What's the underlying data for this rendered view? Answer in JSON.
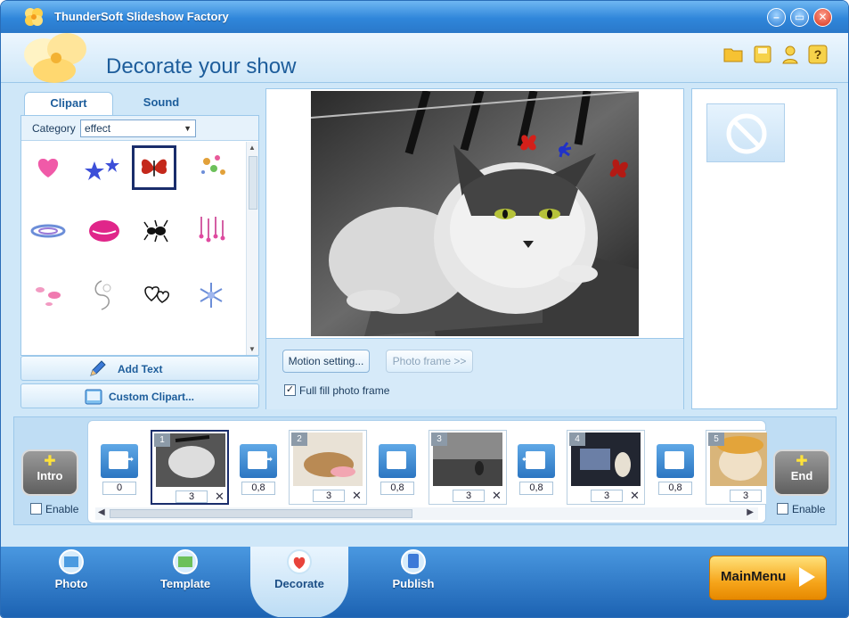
{
  "window": {
    "title": "ThunderSoft Slideshow Factory"
  },
  "header": {
    "title": "Decorate your show",
    "icons": [
      "folder-icon",
      "save-icon",
      "help-person-icon",
      "help-icon"
    ]
  },
  "left_panel": {
    "tabs": [
      {
        "label": "Clipart",
        "active": true
      },
      {
        "label": "Sound",
        "active": false
      }
    ],
    "category_label": "Category",
    "category_value": "effect",
    "clipart_items": [
      "heart",
      "stars",
      "butterfly",
      "sparkles",
      "ring",
      "lips",
      "ant",
      "drops",
      "petals",
      "swirl",
      "hearts",
      "snowflake"
    ],
    "selected_clipart": "butterfly",
    "add_text_label": "Add Text",
    "custom_clipart_label": "Custom Clipart..."
  },
  "preview": {
    "motion_setting_label": "Motion setting...",
    "photo_frame_label": "Photo frame >>",
    "full_fill_label": "Full fill photo frame",
    "full_fill_checked": true
  },
  "timeline": {
    "intro": {
      "label": "Intro",
      "enable_label": "Enable"
    },
    "end": {
      "label": "End",
      "enable_label": "Enable"
    },
    "transitions": [
      "0",
      "0,8",
      "0,8",
      "0,8",
      "0,8"
    ],
    "slides": [
      {
        "num": "1",
        "duration": "3"
      },
      {
        "num": "2",
        "duration": "3"
      },
      {
        "num": "3",
        "duration": "3"
      },
      {
        "num": "4",
        "duration": "3"
      },
      {
        "num": "5",
        "duration": "3"
      }
    ]
  },
  "nav": {
    "items": [
      {
        "label": "Photo"
      },
      {
        "label": "Template"
      },
      {
        "label": "Decorate",
        "active": true
      },
      {
        "label": "Publish"
      }
    ],
    "main_menu_label": "MainMenu"
  }
}
